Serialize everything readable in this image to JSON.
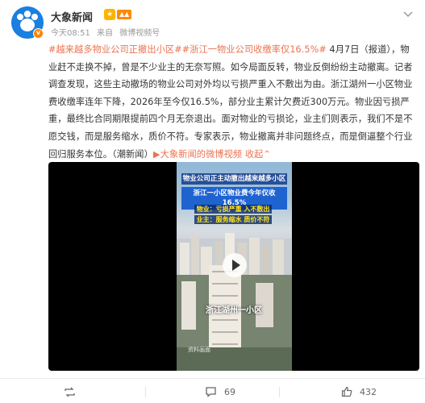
{
  "account": {
    "name": "大象新闻",
    "time": "今天08:51",
    "source_prefix": "来自",
    "source": "微博视频号"
  },
  "post": {
    "tag1": "#越来越多物业公司正撤出小区#",
    "tag2": "#浙江一物业公司收缴率仅16.5%#",
    "body": " 4月7日（报道），物业赶不走换不掉，曾是不少业主的无奈写照。如今局面反转，物业反倒纷纷主动撤离。记者调查发现，这些主动撤场的物业公司对外均以亏损严重入不敷出为由。浙江湖州一小区物业费收缴率连年下降，2026年至今仅16.5%，部分业主累计欠费近300万元。物业因亏损严重，最终比合同期限提前四个月无奈退出。面对物业的亏损论，业主们则表示，我们不是不愿交钱，而是服务缩水，质价不符。专家表示，物业撤离并非问题终点，而是倒逼整个行业回归服务本位。（潮新闻）",
    "video_link": "大象新闻的微博视频",
    "collapse": "收起"
  },
  "video": {
    "caption1": "物业公司正主动撤出越来越多小区",
    "caption2": "浙江一小区物业费今年仅收16.5%",
    "caption3": "物业：亏损严重 入不敷出",
    "caption4": "业主：服务缩水 质价不符",
    "place": "浙江湖州一小区",
    "source": "资料画面"
  },
  "actions": {
    "comments": "69",
    "likes": "432"
  },
  "colors": {
    "accent": "#eb7350",
    "avatar_blue": "#1a7fe0",
    "verified_orange": "#ff8200"
  }
}
